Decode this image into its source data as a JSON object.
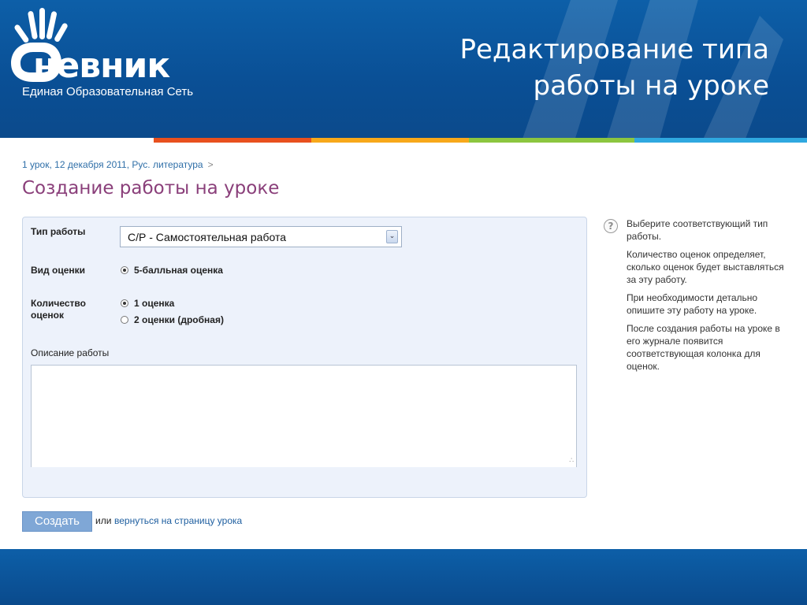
{
  "brand": {
    "name": "невник",
    "tagline": "Единая Образовательная Сеть"
  },
  "slide_title": "Редактирование типа работы на уроке",
  "colors": {
    "header_blue": "#0b5aa3",
    "title_purple": "#8a3f7a",
    "link_blue": "#2f6fa8",
    "panel_bg": "#edf2fb",
    "button_blue": "#7fa7d6",
    "stripe": [
      "#e8501e",
      "#f7a81b",
      "#f5c518",
      "#8cc63f",
      "#2fa8e0"
    ]
  },
  "breadcrumb": {
    "text": "1 урок, 12 декабря 2011, Рус. литература",
    "separator": ">"
  },
  "form": {
    "title": "Создание работы на уроке",
    "work_type_label": "Тип работы",
    "work_type_value": "С/Р - Самостоятельная работа",
    "grade_kind_label": "Вид оценки",
    "grade_kind_option": "5-балльная оценка",
    "grade_count_label": "Количество оценок",
    "grade_count_options": [
      "1 оценка",
      "2 оценки (дробная)"
    ],
    "grade_count_selected": 0,
    "description_label": "Описание работы",
    "description_value": ""
  },
  "actions": {
    "create_label": "Создать",
    "or_text": "или",
    "back_link": "вернуться на страницу урока"
  },
  "help": {
    "icon": "question-icon",
    "paragraphs": [
      "Выберите соответствующий тип работы.",
      "Количество оценок определяет, сколько оценок будет выставляться за эту работу.",
      "При необходимости детально опишите эту работу на уроке.",
      "После создания работы на уроке в его журнале появится соответствующая колонка для оценок."
    ]
  }
}
